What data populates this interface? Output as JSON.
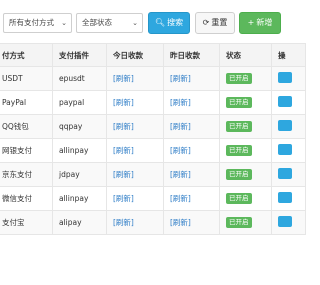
{
  "toolbar": {
    "type_filter": "所有支付方式",
    "status_filter": "全部状态",
    "search_label": "搜索",
    "reset_label": "重置",
    "add_label": "新增",
    "colors": {
      "search": "#2ea7df",
      "add": "#5cb85c"
    }
  },
  "table": {
    "headers": [
      "付方式",
      "支付插件",
      "今日收款",
      "昨日收款",
      "状态",
      "操"
    ],
    "rows": [
      {
        "name": "USDT",
        "plugin": "epusdt",
        "today": "[刷新]",
        "yesterday": "[刷新]",
        "status": "已开启"
      },
      {
        "name": "PayPal",
        "plugin": "paypal",
        "today": "[刷新]",
        "yesterday": "[刷新]",
        "status": "已开启"
      },
      {
        "name": "QQ钱包",
        "plugin": "qqpay",
        "today": "[刷新]",
        "yesterday": "[刷新]",
        "status": "已开启"
      },
      {
        "name": "网银支付",
        "plugin": "allinpay",
        "today": "[刷新]",
        "yesterday": "[刷新]",
        "status": "已开启"
      },
      {
        "name": "京东支付",
        "plugin": "jdpay",
        "today": "[刷新]",
        "yesterday": "[刷新]",
        "status": "已开启"
      },
      {
        "name": "微信支付",
        "plugin": "allinpay",
        "today": "[刷新]",
        "yesterday": "[刷新]",
        "status": "已开启"
      },
      {
        "name": "支付宝",
        "plugin": "alipay",
        "today": "[刷新]",
        "yesterday": "[刷新]",
        "status": "已开启"
      }
    ]
  }
}
